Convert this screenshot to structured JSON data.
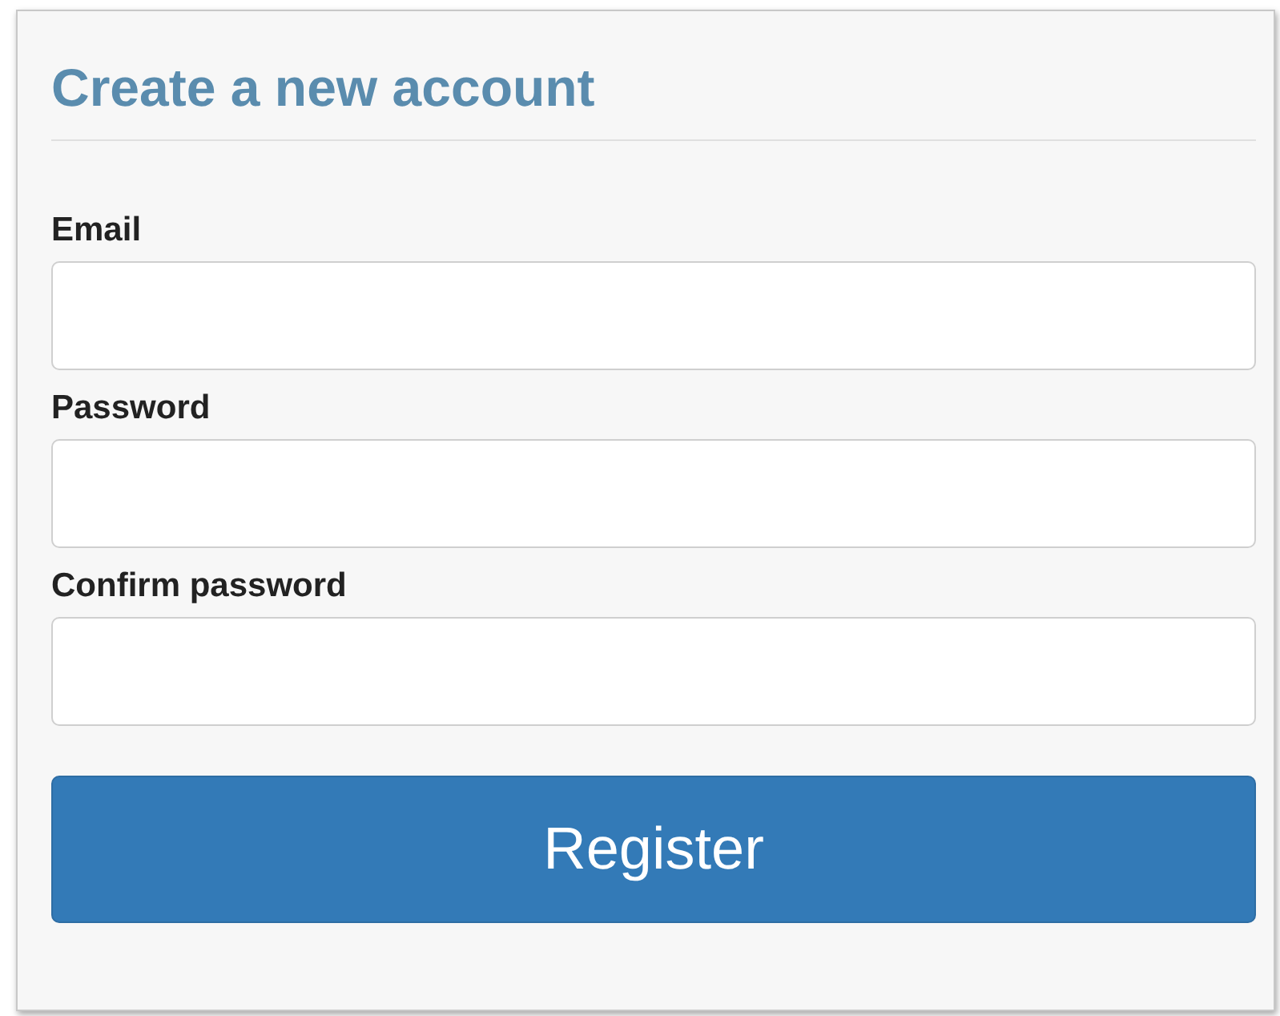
{
  "title": "Create a new account",
  "fields": [
    {
      "label": "Email"
    },
    {
      "label": "Password"
    },
    {
      "label": "Confirm password"
    }
  ],
  "button": "Register"
}
